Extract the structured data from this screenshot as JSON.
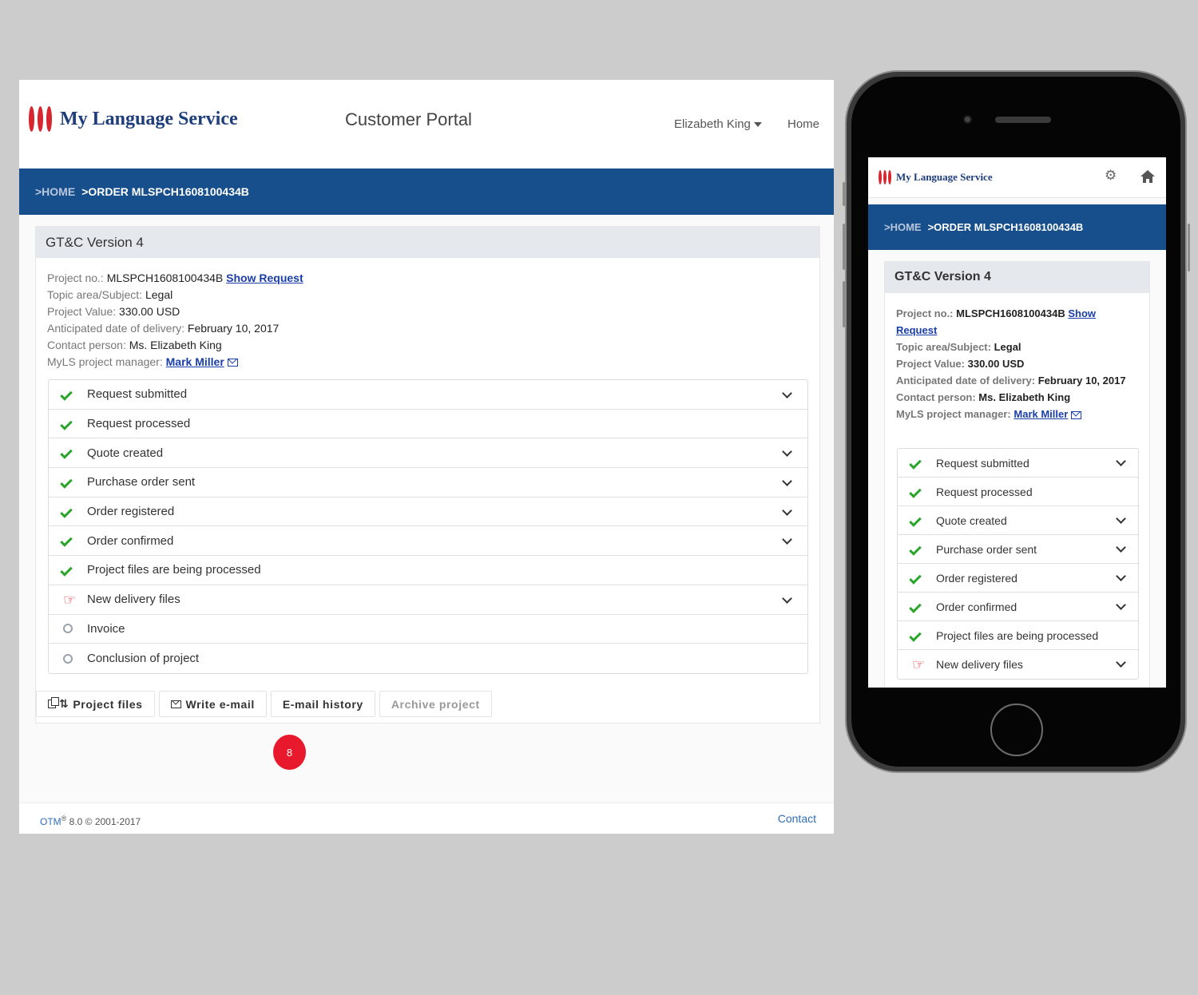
{
  "desktop": {
    "brand": "My Language Service",
    "portal_title": "Customer Portal",
    "user_name": "Elizabeth King",
    "home_link": "Home",
    "breadcrumb": {
      "home": ">HOME",
      "order": ">ORDER MLSPCH1608100434B"
    },
    "card_title": "GT&C Version 4",
    "info": {
      "project_no_label": "Project no.:",
      "project_no": "MLSPCH1608100434B",
      "show_request": "Show Request",
      "topic_label": "Topic area/Subject:",
      "topic": "Legal",
      "value_label": "Project Value:",
      "value": "330.00 USD",
      "delivery_label": "Anticipated date of delivery:",
      "delivery": "February 10, 2017",
      "contact_label": "Contact person:",
      "contact": "Ms. Elizabeth King",
      "manager_label": "MyLS project manager:",
      "manager": "Mark Miller"
    },
    "steps": [
      {
        "label": "Request submitted",
        "status": "done",
        "expandable": true
      },
      {
        "label": "Request processed",
        "status": "done",
        "expandable": false
      },
      {
        "label": "Quote created",
        "status": "done",
        "expandable": true
      },
      {
        "label": "Purchase order sent",
        "status": "done",
        "expandable": true
      },
      {
        "label": "Order registered",
        "status": "done",
        "expandable": true
      },
      {
        "label": "Order confirmed",
        "status": "done",
        "expandable": true
      },
      {
        "label": "Project files are being processed",
        "status": "done",
        "expandable": false
      },
      {
        "label": "New delivery files",
        "status": "action",
        "expandable": true
      },
      {
        "label": "Invoice",
        "status": "pending",
        "expandable": false
      },
      {
        "label": "Conclusion of project",
        "status": "pending",
        "expandable": false
      }
    ],
    "buttons": {
      "project_files": "Project files",
      "write_email": "Write e-mail",
      "email_history": "E-mail history",
      "archive_project": "Archive project"
    },
    "badge": "8",
    "footer": {
      "otm": "OTM",
      "reg": "®",
      "version": " 8.0  © 2001-2017",
      "contact": "Contact"
    }
  },
  "mobile": {
    "brand": "My Language Service",
    "breadcrumb": {
      "home": ">HOME",
      "order": ">ORDER MLSPCH1608100434B"
    },
    "card_title": "GT&C Version 4",
    "info": {
      "project_no_label": "Project no.:",
      "project_no": "MLSPCH1608100434B",
      "show_request": "Show Request",
      "topic_label": "Topic area/Subject:",
      "topic": "Legal",
      "value_label": "Project Value:",
      "value": "330.00 USD",
      "delivery_label": "Anticipated date of delivery:",
      "delivery": "February 10, 2017",
      "contact_label": "Contact person:",
      "contact": "Ms. Elizabeth King",
      "manager_label": "MyLS project manager:",
      "manager": "Mark Miller"
    },
    "steps": [
      {
        "label": "Request submitted",
        "status": "done",
        "expandable": true
      },
      {
        "label": "Request processed",
        "status": "done",
        "expandable": false
      },
      {
        "label": "Quote created",
        "status": "done",
        "expandable": true
      },
      {
        "label": "Purchase order sent",
        "status": "done",
        "expandable": true
      },
      {
        "label": "Order registered",
        "status": "done",
        "expandable": true
      },
      {
        "label": "Order confirmed",
        "status": "done",
        "expandable": true
      },
      {
        "label": "Project files are being processed",
        "status": "done",
        "expandable": false
      },
      {
        "label": "New delivery files",
        "status": "action",
        "expandable": true
      }
    ]
  },
  "colors": {
    "accent": "#164f8c",
    "brand_red": "#d8262e",
    "done": "#2aa52a",
    "badge": "#e8192c"
  }
}
